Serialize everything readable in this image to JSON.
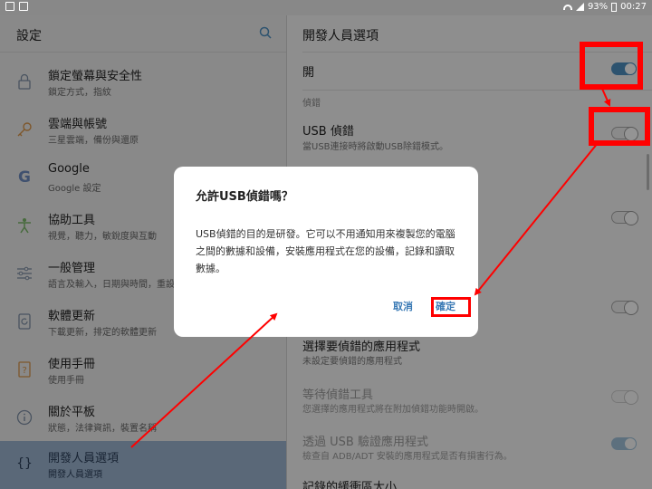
{
  "status_bar": {
    "left_icons": [
      "image-icon",
      "download-icon"
    ],
    "battery": "93%",
    "time": "00:27"
  },
  "left_panel": {
    "title": "設定",
    "items": [
      {
        "title": "鎖定螢幕與安全性",
        "sub": "鎖定方式，指紋",
        "icon": "lock-icon"
      },
      {
        "title": "雲端與帳號",
        "sub": "三星雲端，備份與還原",
        "icon": "key-icon"
      },
      {
        "title": "Google",
        "sub": "Google 設定",
        "icon": "google-icon"
      },
      {
        "title": "協助工具",
        "sub": "視覺，聽力，敏銳度與互動",
        "icon": "accessibility-icon"
      },
      {
        "title": "一般管理",
        "sub": "語言及輸入，日期與時間，重設",
        "icon": "sliders-icon"
      },
      {
        "title": "軟體更新",
        "sub": "下載更新，排定的軟體更新",
        "icon": "update-icon"
      },
      {
        "title": "使用手冊",
        "sub": "使用手冊",
        "icon": "manual-icon"
      },
      {
        "title": "關於平板",
        "sub": "狀態，法律資訊，裝置名稱",
        "icon": "info-icon"
      },
      {
        "title": "開發人員選項",
        "sub": "開發人員選項",
        "icon": "braces-icon"
      }
    ]
  },
  "right_panel": {
    "title": "開發人員選項",
    "master_label": "開",
    "debug_header": "偵錯",
    "usb_debug": {
      "label": "USB 偵錯",
      "sub": "當USB連接時將啟動USB除錯模式。"
    },
    "select_app": {
      "label": "選擇要偵錯的應用程式",
      "sub": "未設定要偵錯的應用程式"
    },
    "wait_debugger": {
      "label": "等待偵錯工具",
      "sub": "您選擇的應用程式將在附加偵錯功能時開啟。"
    },
    "verify_usb": {
      "label": "透過 USB 驗證應用程式",
      "sub": "檢查自 ADB/ADT 安裝的應用程式是否有損害行為。"
    },
    "buffer": {
      "label": "記錄的緩衝區大小"
    }
  },
  "dialog": {
    "title": "允許USB偵錯嗎？",
    "body": "USB偵錯的目的是研發。它可以不用通知用來複製您的電腦之間的數據和設備，安裝應用程式在您的設備，記錄和讀取數據。",
    "cancel": "取消",
    "ok": "確定"
  },
  "colors": {
    "accent": "#3a7ab5",
    "annotation": "#ff0000",
    "selected_row": "#9bb4cf"
  }
}
